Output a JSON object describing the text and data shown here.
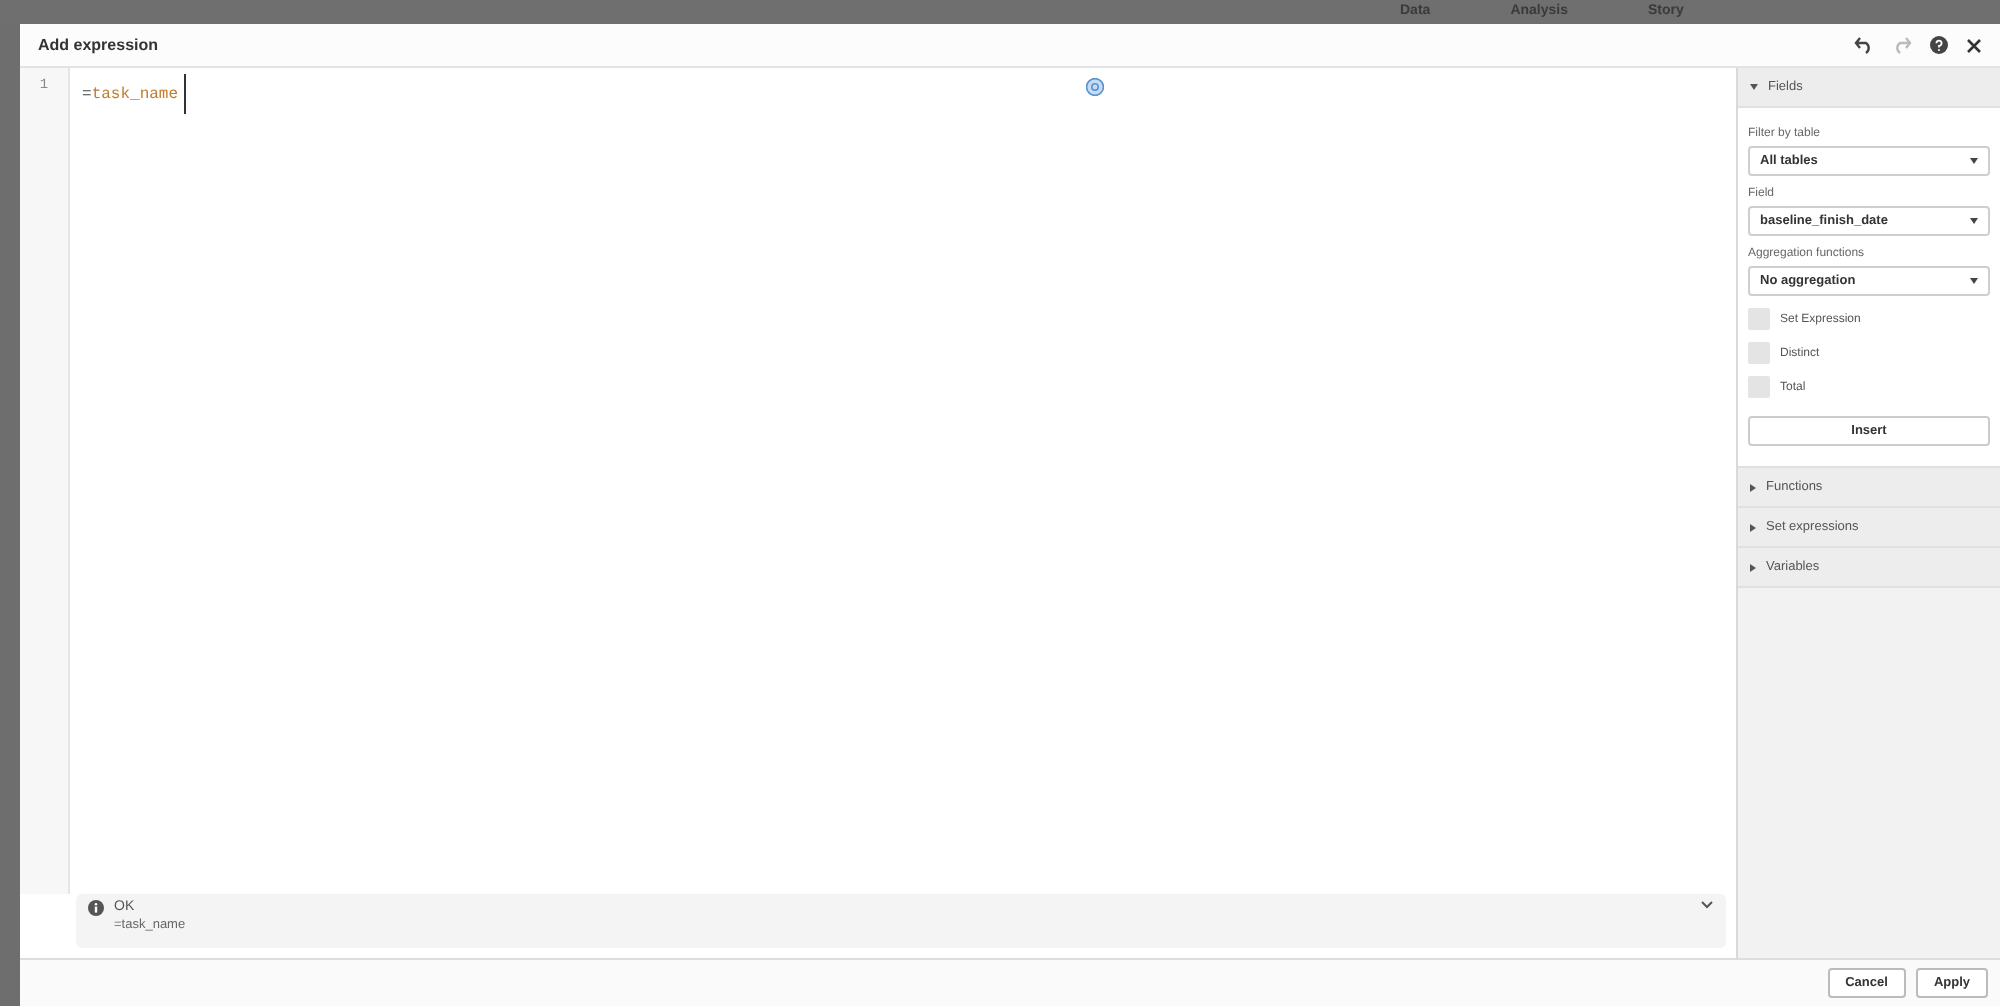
{
  "background_app": {
    "tabs": [
      {
        "label": "Data"
      },
      {
        "label": "Analysis"
      },
      {
        "label": "Story"
      }
    ]
  },
  "dialog": {
    "title": "Add expression",
    "editor": {
      "line_numbers": [
        "1"
      ],
      "tokens": [
        {
          "text": "=",
          "kind": "operator"
        },
        {
          "text": "task_name",
          "kind": "field"
        }
      ]
    },
    "status": {
      "label": "OK",
      "expression": "=task_name"
    },
    "panel": {
      "sections": [
        {
          "label": "Fields",
          "expanded": true
        },
        {
          "label": "Functions",
          "expanded": false
        },
        {
          "label": "Set expressions",
          "expanded": false
        },
        {
          "label": "Variables",
          "expanded": false
        }
      ],
      "filter_label": "Filter by table",
      "filter_value": "All tables",
      "field_label": "Field",
      "field_value": "baseline_finish_date",
      "aggregation_label": "Aggregation functions",
      "aggregation_value": "No aggregation",
      "options": [
        {
          "label": "Set Expression",
          "checked": false
        },
        {
          "label": "Distinct",
          "checked": false
        },
        {
          "label": "Total",
          "checked": false
        }
      ],
      "insert": "Insert"
    },
    "buttons": [
      "Cancel",
      "Apply"
    ]
  }
}
